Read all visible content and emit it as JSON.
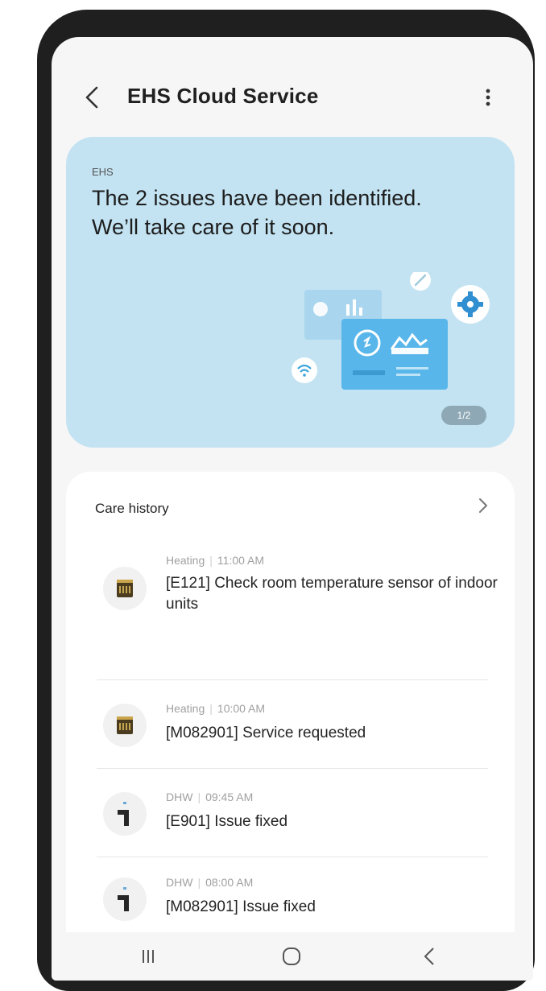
{
  "header": {
    "title": "EHS  Cloud Service"
  },
  "banner": {
    "tag": "EHS",
    "message": "The 2 issues have been identified. We’ll take care of it soon.",
    "page_indicator": "1/2",
    "background_color": "#c3e3f2"
  },
  "care_history": {
    "title": "Care history",
    "items": [
      {
        "category": "Heating",
        "time": "11:00 AM",
        "message": "[E121] Check room temperature sensor of indoor units",
        "icon": "heating-icon"
      },
      {
        "category": "Heating",
        "time": "10:00 AM",
        "message": "[M082901] Service requested",
        "icon": "heating-icon"
      },
      {
        "category": "DHW",
        "time": "09:45 AM",
        "message": "[E901] Issue fixed",
        "icon": "water-tap-icon"
      },
      {
        "category": "DHW",
        "time": "08:00 AM",
        "message": "[M082901] Issue fixed",
        "icon": "water-tap-icon"
      }
    ]
  },
  "navbar": {
    "icons": [
      "recent-apps-icon",
      "home-icon",
      "back-icon"
    ]
  }
}
